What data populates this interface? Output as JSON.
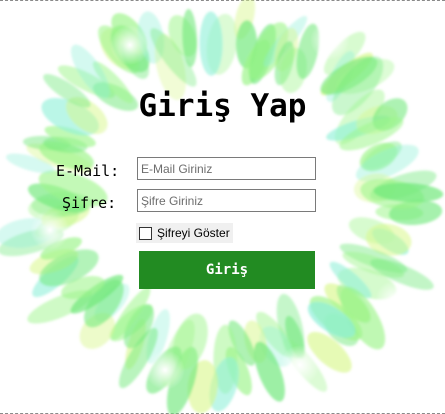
{
  "colors": {
    "accent": "#228B22",
    "wreath_light": "#9df58a",
    "wreath_mid": "#6fe87a",
    "wreath_cyan": "#8ff0d8",
    "wreath_yellow": "#d8f78a"
  },
  "login": {
    "title": "Giriş Yap",
    "email_label": "E-Mail:",
    "email_placeholder": "E-Mail Giriniz",
    "password_label": "Şifre:",
    "password_placeholder": "Şifre Giriniz",
    "show_password_label": "Şifreyi Göster",
    "show_password_checked": false,
    "submit_label": "Giriş"
  }
}
